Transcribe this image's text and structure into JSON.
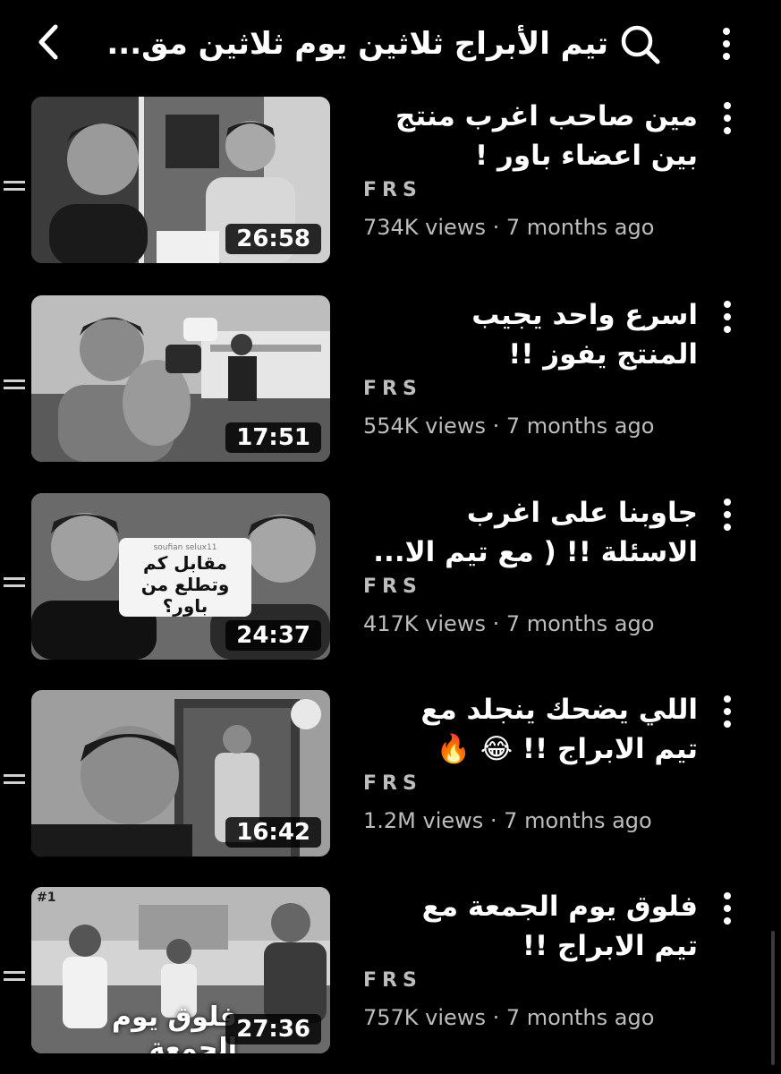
{
  "header": {
    "back_icon": "chevron-left-icon",
    "search_icon": "search-icon",
    "menu_icon": "kebab-icon",
    "query": "تيم الأبراج ثلاثين يوم ثلاثين مق..."
  },
  "videos": [
    {
      "title_line1": "مين صاحب اغرب منتج",
      "title_line2": "بين اعضاء باور !",
      "channel": "FRS",
      "views": "734K views",
      "age": "7 months ago",
      "duration": "26:58"
    },
    {
      "title_line1": "اسرع واحد يجيب",
      "title_line2": "المنتج يفوز !!",
      "channel": "FRS",
      "views": "554K views",
      "age": "7 months ago",
      "duration": "17:51"
    },
    {
      "title_line1": "جاوبنا على اغرب",
      "title_line2": "الاسئلة !! ( مع تيم الا...",
      "channel": "FRS",
      "views": "417K views",
      "age": "7 months ago",
      "duration": "24:37",
      "thumb_card": {
        "user": "soufian selux11",
        "line1": "مقابل كم",
        "line2": "وتطلع من باور؟"
      }
    },
    {
      "title_line1": "اللي يضحك ينجلد مع",
      "title_line2": "تيم الابراج !! 😂 🔥",
      "channel": "FRS",
      "views": "1.2M views",
      "age": "7 months ago",
      "duration": "16:42"
    },
    {
      "title_line1": "فلوق يوم الجمعة مع",
      "title_line2": "تيم الابراج !!",
      "channel": "FRS",
      "views": "757K views",
      "age": "7 months ago",
      "duration": "27:36",
      "thumb_caption": "فلوق يوم الجمعة",
      "thumb_badge": "#1"
    }
  ]
}
